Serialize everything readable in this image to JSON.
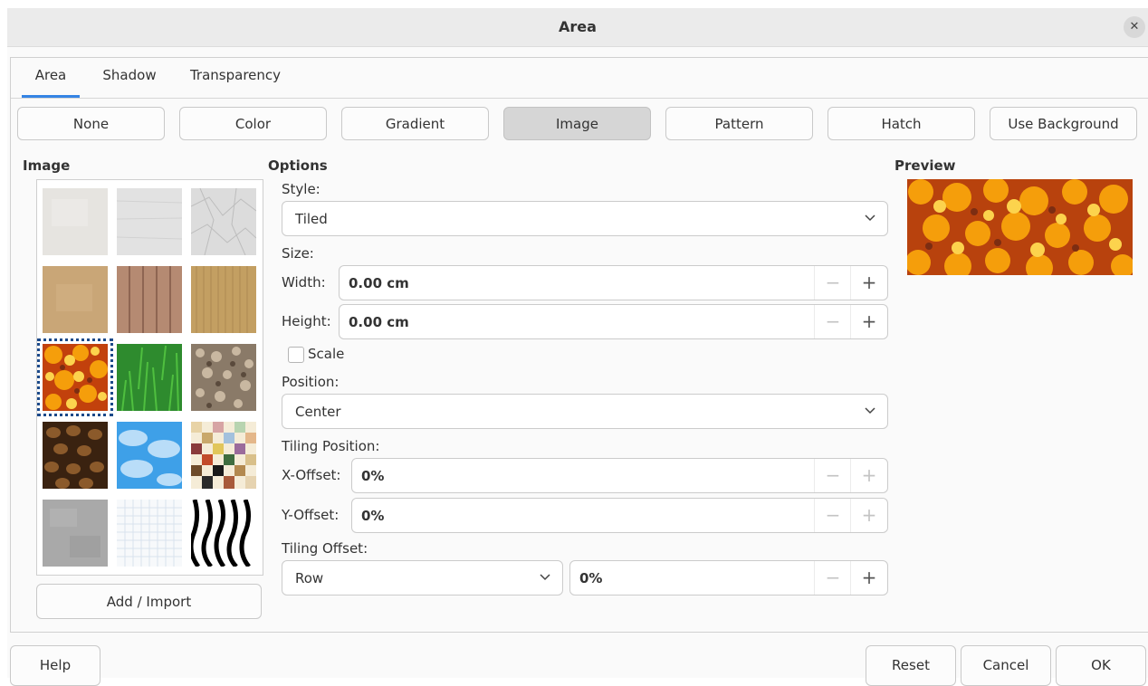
{
  "dialog": {
    "title": "Area",
    "close_icon": "close-icon"
  },
  "tabs": [
    {
      "label": "Area",
      "active": true
    },
    {
      "label": "Shadow",
      "active": false
    },
    {
      "label": "Transparency",
      "active": false
    }
  ],
  "fill_buttons": [
    {
      "label": "None",
      "selected": false
    },
    {
      "label": "Color",
      "selected": false
    },
    {
      "label": "Gradient",
      "selected": false
    },
    {
      "label": "Image",
      "selected": true
    },
    {
      "label": "Pattern",
      "selected": false
    },
    {
      "label": "Hatch",
      "selected": false
    },
    {
      "label": "Use Background",
      "selected": false
    }
  ],
  "image_panel": {
    "heading": "Image",
    "thumbnails": [
      "paper-white",
      "paper-gray",
      "paper-crumpled",
      "paper-brown",
      "wood-planks",
      "cardboard",
      "autumn-leaves",
      "grass",
      "pebbles",
      "coffee-beans",
      "sky-clouds",
      "color-mosaic",
      "concrete",
      "graph-paper",
      "zebra"
    ],
    "selected_thumbnail": "autumn-leaves",
    "add_import_label": "Add / Import"
  },
  "options": {
    "heading": "Options",
    "style_label": "Style:",
    "style_value": "Tiled",
    "size_label": "Size:",
    "width_label": "Width:",
    "width_value": "0.00 cm",
    "height_label": "Height:",
    "height_value": "0.00 cm",
    "scale_label": "Scale",
    "scale_checked": false,
    "position_label": "Position:",
    "position_value": "Center",
    "tiling_position_label": "Tiling Position:",
    "x_offset_label": "X-Offset:",
    "x_offset_value": "0%",
    "y_offset_label": "Y-Offset:",
    "y_offset_value": "0%",
    "tiling_offset_label": "Tiling Offset:",
    "tiling_offset_mode": "Row",
    "tiling_offset_value": "0%"
  },
  "preview": {
    "heading": "Preview"
  },
  "footer": {
    "help": "Help",
    "reset": "Reset",
    "cancel": "Cancel",
    "ok": "OK"
  },
  "colors": {
    "accent": "#3584e4",
    "selection_outline": "#1c4a8a",
    "selected_button": "#d6d6d6"
  }
}
